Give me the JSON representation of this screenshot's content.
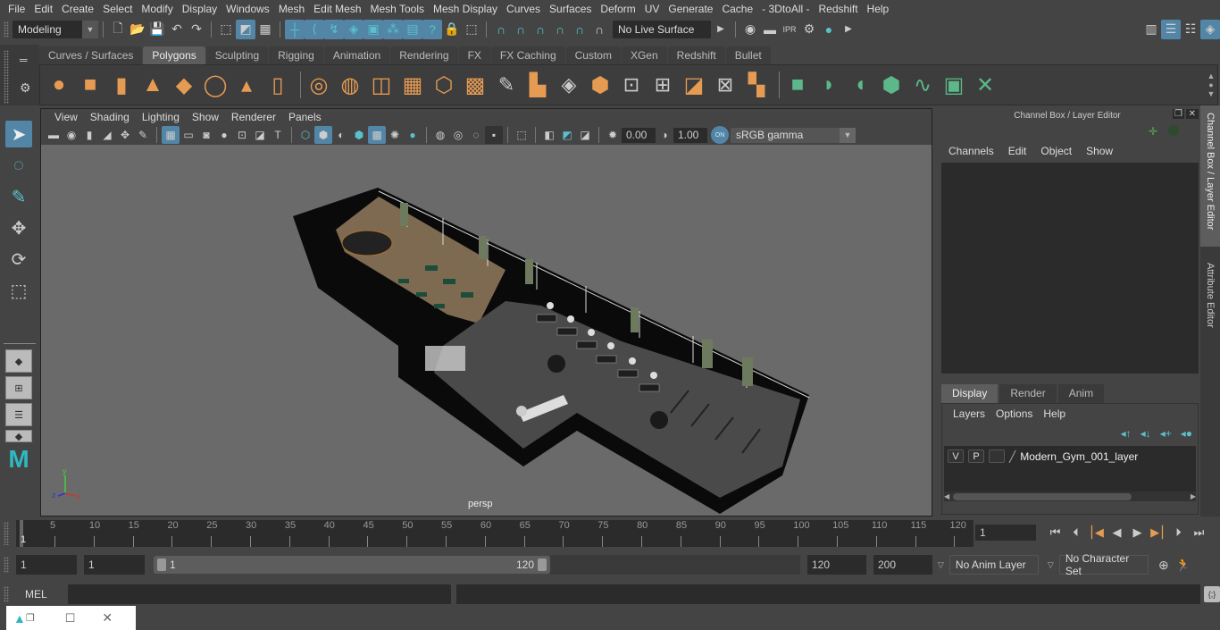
{
  "menubar": {
    "items": [
      "File",
      "Edit",
      "Create",
      "Select",
      "Modify",
      "Display",
      "Windows",
      "Mesh",
      "Edit Mesh",
      "Mesh Tools",
      "Mesh Display",
      "Curves",
      "Surfaces",
      "Deform",
      "UV",
      "Generate",
      "Cache",
      "- 3DtoAll -",
      "Redshift",
      "Help"
    ]
  },
  "statusline": {
    "workspace": "Modeling",
    "live_surface": "No Live Surface"
  },
  "shelf": {
    "tabs": [
      "Curves / Surfaces",
      "Polygons",
      "Sculpting",
      "Rigging",
      "Animation",
      "Rendering",
      "FX",
      "FX Caching",
      "Custom",
      "XGen",
      "Redshift",
      "Bullet"
    ],
    "active_tab": "Polygons"
  },
  "viewport": {
    "menu": [
      "View",
      "Shading",
      "Lighting",
      "Show",
      "Renderer",
      "Panels"
    ],
    "exposure": "0.00",
    "gamma": "1.00",
    "color_mgmt_toggle": "ON",
    "color_space": "sRGB gamma",
    "camera_label": "persp",
    "axis": {
      "x": "x",
      "y": "y",
      "z": "z"
    }
  },
  "channelbox": {
    "title": "Channel Box / Layer Editor",
    "menu": [
      "Channels",
      "Edit",
      "Object",
      "Show"
    ]
  },
  "layereditor": {
    "tabs": [
      "Display",
      "Render",
      "Anim"
    ],
    "active_tab": "Display",
    "menu": [
      "Layers",
      "Options",
      "Help"
    ],
    "layers": [
      {
        "v": "V",
        "p": "P",
        "name": "Modern_Gym_001_layer"
      }
    ]
  },
  "side_tabs": [
    "Channel Box / Layer Editor",
    "Attribute Editor"
  ],
  "timeline": {
    "ticks": [
      5,
      10,
      15,
      20,
      25,
      30,
      35,
      40,
      45,
      50,
      55,
      60,
      65,
      70,
      75,
      80,
      85,
      90,
      95,
      100,
      105,
      110,
      115,
      120
    ],
    "start_label": "1",
    "current_frame": "1"
  },
  "range": {
    "start": "1",
    "playback_start": "1",
    "slider_min": "1",
    "slider_max": "120",
    "playback_end": "120",
    "end": "200",
    "anim_layer": "No Anim Layer",
    "character_set": "No Character Set"
  },
  "cmdline": {
    "label": "MEL"
  },
  "colors": {
    "accent": "#5285a6",
    "shelf_orange": "#e69b52",
    "shelf_green": "#5cb88a",
    "teal": "#5bc0cc"
  }
}
